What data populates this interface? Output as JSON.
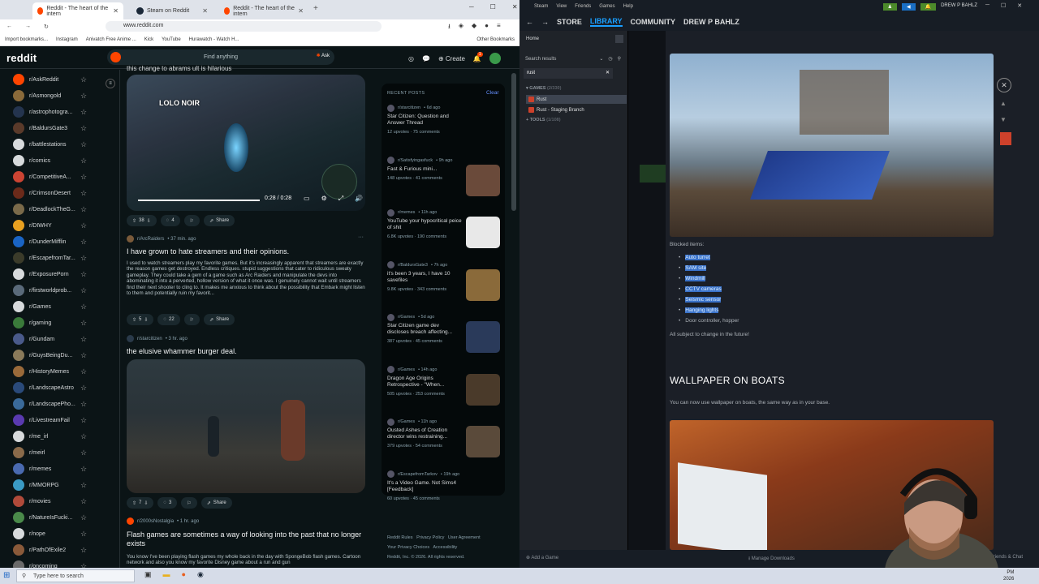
{
  "browser": {
    "tabs": [
      {
        "label": "Reddit - The heart of the intern"
      },
      {
        "label": "Steam on Reddit"
      },
      {
        "label": "Reddit - The heart of the intern"
      }
    ],
    "url": "www.reddit.com",
    "bookmarks": [
      "Import bookmarks...",
      "Instagram",
      "Anivatch Free Anime ...",
      "Kick",
      "YouTube",
      "Hurawatch - Watch H...",
      "Other Bookmarks"
    ]
  },
  "reddit": {
    "logo": "reddit",
    "search_placeholder": "Find anything",
    "ask": "Ask",
    "create": "Create",
    "notif_count": "1",
    "communities": [
      {
        "name": "r/AskReddit",
        "color": "#ff4500"
      },
      {
        "name": "r/Asmongold",
        "color": "#8a6a3a"
      },
      {
        "name": "r/astrophotogra...",
        "color": "#24344e"
      },
      {
        "name": "r/BaldursGate3",
        "color": "#5a3a2a"
      },
      {
        "name": "r/battlestations",
        "color": "#d7dadc"
      },
      {
        "name": "r/comics",
        "color": "#d7dadc"
      },
      {
        "name": "r/CompetitiveA...",
        "color": "#c43"
      },
      {
        "name": "r/CrimsonDesert",
        "color": "#6b2a1a"
      },
      {
        "name": "r/DeadlockTheG...",
        "color": "#7a6a4a"
      },
      {
        "name": "r/DIWHY",
        "color": "#e8a020"
      },
      {
        "name": "r/DunderMifflin",
        "color": "#1a64c4"
      },
      {
        "name": "r/EscapefromTar...",
        "color": "#3b3b2a"
      },
      {
        "name": "r/ExposurePorn",
        "color": "#d7dadc"
      },
      {
        "name": "r/firstworldprob...",
        "color": "#5a6a7a"
      },
      {
        "name": "r/Games",
        "color": "#d7dadc"
      },
      {
        "name": "r/gaming",
        "color": "#3a7a3a"
      },
      {
        "name": "r/Gundam",
        "color": "#4a5a8a"
      },
      {
        "name": "r/GuysBeingDu...",
        "color": "#8a7a5a"
      },
      {
        "name": "r/HistoryMemes",
        "color": "#9a6a3a"
      },
      {
        "name": "r/LandscapeAstro",
        "color": "#2a4a7a"
      },
      {
        "name": "r/LandscapePho...",
        "color": "#3a6a9a"
      },
      {
        "name": "r/LivestreamFail",
        "color": "#5a3ab0"
      },
      {
        "name": "r/me_irl",
        "color": "#d7dadc"
      },
      {
        "name": "r/meirl",
        "color": "#8a6a4a"
      },
      {
        "name": "r/memes",
        "color": "#4a6ab0"
      },
      {
        "name": "r/MMORPG",
        "color": "#3a9ac4"
      },
      {
        "name": "r/movies",
        "color": "#b04a3a"
      },
      {
        "name": "r/NatureIsFucki...",
        "color": "#4a8a4a"
      },
      {
        "name": "r/nope",
        "color": "#d7dadc"
      },
      {
        "name": "r/PathOfExile2",
        "color": "#8a5a3a"
      },
      {
        "name": "r/oncoming",
        "color": "#6a6a6a"
      }
    ],
    "video": {
      "time": "0:28 / 0:28",
      "overlay": "LOLO NOIR",
      "top_title": "this change to abrams ult is hilarious"
    },
    "posts": [
      {
        "votes": "38",
        "comments": "4",
        "share": "Share"
      },
      {
        "subreddit": "r/ArcRaiders",
        "age": "• 37 min. ago",
        "title": "I have grown to hate streamers and their opinions.",
        "body": "I used to watch streamers play my favorite games. But it's increasingly apparent that streamers are exactly the reason games get destroyed. Endless critiques. stupid suggestions that cater to ridiculous sweaty gameplay. They could take a gem of a game such as Arc Raiders and manipulate the devs into abominating it into a perverted, hollow version of what it once was. I genuinely cannot wait until streamers find their next shooter to cling to. It makes me anxious to think about the possibility that Embark might listen to them and potentially ruin my favorit...",
        "votes": "5",
        "comments": "22",
        "share": "Share"
      },
      {
        "subreddit": "r/starcitizen",
        "age": "• 3 hr. ago",
        "title": "the elusive whammer burger deal.",
        "votes": "7",
        "comments": "3",
        "share": "Share"
      },
      {
        "subreddit": "r/2000sNostalgia",
        "age": "• 1 hr. ago",
        "title": "Flash games are sometimes a way of looking into the past that no longer exists",
        "body": "You know I've been playing flash games my whole back in the day with SpongeBob flash games. Cartoon network and also you know my favorite Disney game about a run and gun"
      }
    ],
    "recent": {
      "header": "RECENT POSTS",
      "clear": "Clear",
      "items": [
        {
          "sr": "r/starcitizen",
          "age": "• 6d ago",
          "title": "Star Citizen: Question and Answer Thread",
          "meta": "12 upvotes · 75 comments",
          "thumb": ""
        },
        {
          "sr": "r/Satisfyingasfuck",
          "age": "• 9h ago",
          "title": "Fast & Furious mini...",
          "meta": "148 upvotes · 41 comments",
          "thumb": "#6a4a3a"
        },
        {
          "sr": "r/memes",
          "age": "• 11h ago",
          "title": "YouTube your hypocritical peice of shit",
          "meta": "6.8K upvotes · 190 comments",
          "thumb": "#e8e8e8"
        },
        {
          "sr": "r/BaldursGate3",
          "age": "• 7h ago",
          "title": "it's been 3 years, I have 10 savefiles",
          "meta": "9.8K upvotes · 343 comments",
          "thumb": "#8a6a3a"
        },
        {
          "sr": "r/Games",
          "age": "• 5d ago",
          "title": "Star Citizen game dev discloses breach affecting...",
          "meta": "387 upvotes · 45 comments",
          "thumb": "#2a3a5a"
        },
        {
          "sr": "r/Games",
          "age": "• 14h ago",
          "title": "Dragon Age Origins Retrospective - \"When...",
          "meta": "505 upvotes · 253 comments",
          "thumb": "#4a3a2a"
        },
        {
          "sr": "r/Games",
          "age": "• 11h ago",
          "title": "Ousted Ashes of Creation director wins restraining...",
          "meta": "379 upvotes · 54 comments",
          "thumb": "#5a4a3a"
        },
        {
          "sr": "r/EscapefromTarkov",
          "age": "• 19h ago",
          "title": "It's a Video Game. Not Sims4 [Feedback]",
          "meta": "60 upvotes · 45 comments",
          "thumb": ""
        }
      ]
    },
    "footer": [
      "Reddit Rules",
      "Privacy Policy",
      "User Agreement",
      "Your Privacy Choices",
      "Accessibility",
      "Reddit, Inc. © 2026. All rights reserved."
    ]
  },
  "steam": {
    "menu": [
      "Steam",
      "View",
      "Friends",
      "Games",
      "Help"
    ],
    "nav": {
      "store": "STORE",
      "library": "LIBRARY",
      "community": "COMMUNITY",
      "user": "DREW P BAHLZ"
    },
    "account": "DREW P BAHLZ",
    "home": "Home",
    "search_results": "Search results",
    "filter": "rust",
    "games_cat": "GAMES",
    "games_count": "(2/330)",
    "games": [
      "Rust",
      "Rust - Staging Branch"
    ],
    "tools_cat": "TOOLS",
    "tools_count": "(1/108)",
    "blocked_label": "Blocked items:",
    "blocked_items": [
      "Auto turret",
      "SAM site",
      "Windmill",
      "CCTV cameras",
      "Seismic sensor",
      "Hanging lights",
      "Door controller, hopper"
    ],
    "subject": "All subject to change in the future!",
    "wallpaper_heading": "WALLPAPER ON BOATS",
    "wallpaper_desc": "You can now use wallpaper on boats, the same way as in your base.",
    "add_game": "Add a Game",
    "manage_downloads": "Manage Downloads",
    "friends_chat": "Friends & Chat"
  },
  "taskbar": {
    "search": "Type here to search",
    "time": "PM",
    "date": "2026"
  }
}
